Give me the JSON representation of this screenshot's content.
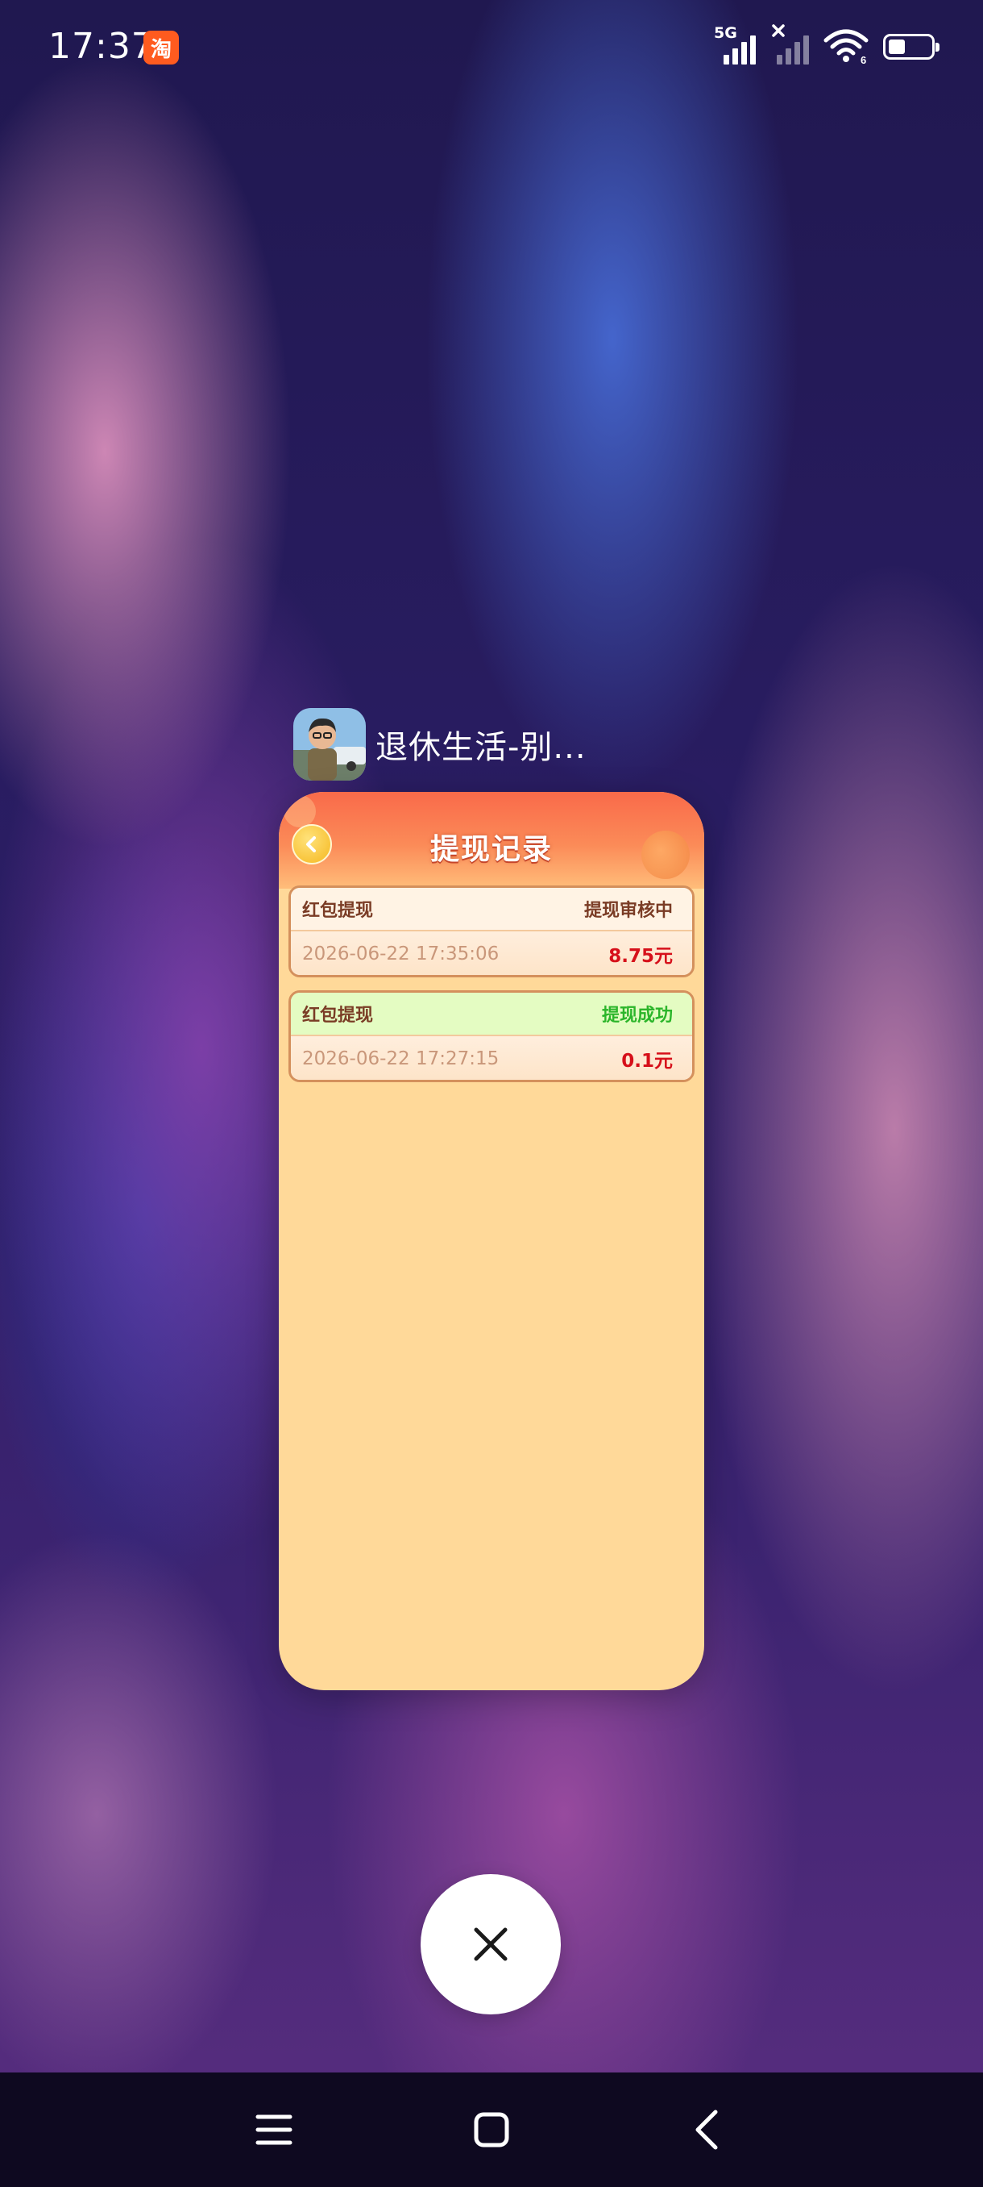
{
  "status_bar": {
    "time": "17:37",
    "notification_app_icon": "taobao-icon",
    "notification_app_glyph": "淘",
    "network_label": "5G",
    "icons": [
      "signal-icon",
      "signal-no-service-icon",
      "wifi-icon",
      "battery-icon"
    ]
  },
  "recent_app": {
    "title": "退休生活-别...",
    "icon": "app-avatar-icon"
  },
  "app_screen": {
    "title": "提现记录",
    "back_icon": "back-arrow-icon",
    "records": [
      {
        "type": "红包提现",
        "status": "提现审核中",
        "time": "2026-06-22 17:35:06",
        "amount": "8.75元"
      },
      {
        "type": "红包提现",
        "status": "提现成功",
        "time": "2026-06-22 17:27:15",
        "amount": "0.1元"
      }
    ]
  },
  "close_button": {
    "icon": "close-icon"
  },
  "navigation": {
    "icons": [
      "menu-icon",
      "home-icon",
      "back-icon"
    ]
  },
  "colors": {
    "header_gradient_top": "#f96a4a",
    "card_background": "#ffd999",
    "amount_red": "#d6101a",
    "success_green": "#2bb52a",
    "pending_brown": "#7a3c25"
  }
}
